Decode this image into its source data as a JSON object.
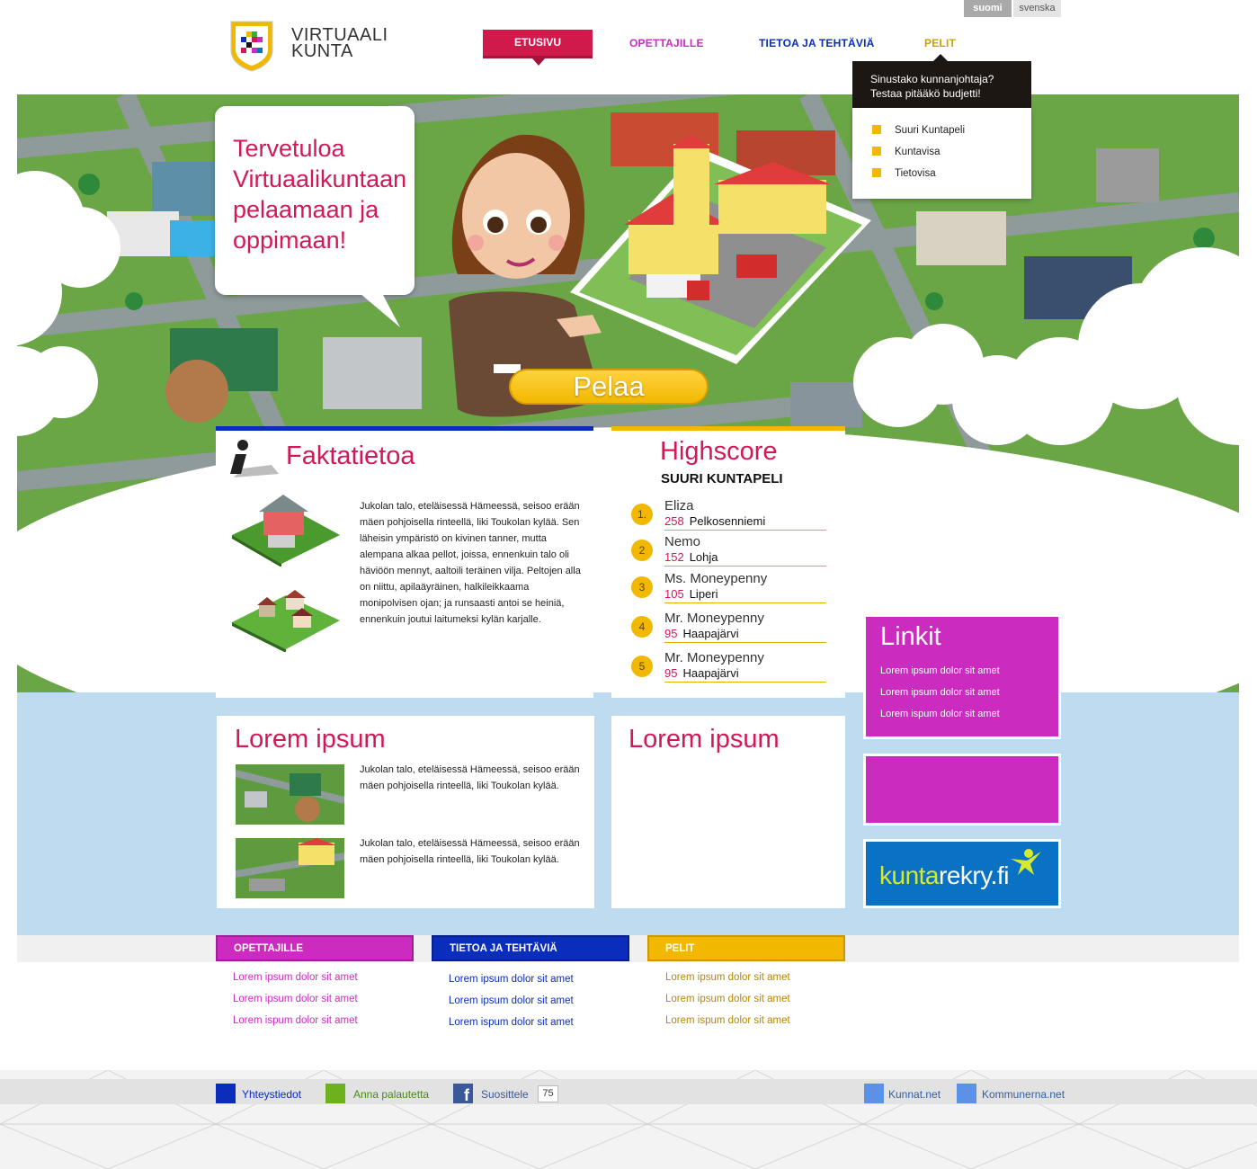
{
  "lang": {
    "active": "suomi",
    "other": "svenska"
  },
  "logo": {
    "line1": "VIRTUAALI",
    "line2": "KUNTA"
  },
  "nav": {
    "etusivu": "ETUSIVU",
    "opettajille": "OPETTAJILLE",
    "tietoa": "TIETOA JA TEHTÄVIÄ",
    "pelit": "PELIT"
  },
  "colors": {
    "pink": "#d11a55",
    "blue": "#0a2dbb",
    "magenta": "#cc2bc0",
    "yellow": "#f2b800",
    "sky": "#bfdbf0"
  },
  "hero": {
    "welcome": "Tervetuloa Virtuaalikuntaan pelaamaan ja oppimaan!",
    "play_button": "Pelaa"
  },
  "dropdown": {
    "line1": "Sinustako kunnanjohtaja?",
    "line2": "Testaa pitääkö budjetti!",
    "items": [
      "Suuri Kuntapeli",
      "Kuntavisa",
      "Tietovisa"
    ]
  },
  "fakta": {
    "title": "Faktatietoa",
    "text": "Jukolan talo, eteläisessä Hämeessä, seisoo erään mäen pohjoisella rinteellä, liki Toukolan kylää. Sen läheisin ympäristö on kivinen tanner, mutta alempana alkaa pellot, joissa, ennenkuin talo oli häviöön mennyt, aaltoili teräinen vilja. Peltojen alla on niittu, apilaäyräinen, halkileikkaama monipolvisen ojan; ja runsaasti antoi se heiniä, ennenkuin joutui laitumeksi kylän karjalle."
  },
  "highscore": {
    "title": "Highscore",
    "subtitle": "SUURI KUNTAPELI",
    "entries": [
      {
        "rank": "1.",
        "name": "Eliza",
        "score": "258",
        "city": "Pelkosenniemi"
      },
      {
        "rank": "2",
        "name": "Nemo",
        "score": "152",
        "city": "Lohja"
      },
      {
        "rank": "3",
        "name": "Ms. Moneypenny",
        "score": "105",
        "city": "Liperi"
      },
      {
        "rank": "4",
        "name": "Mr. Moneypenny",
        "score": "95",
        "city": "Haapajärvi"
      },
      {
        "rank": "5",
        "name": "Mr. Moneypenny",
        "score": "95",
        "city": "Haapajärvi"
      }
    ]
  },
  "lorem1": {
    "title": "Lorem ipsum",
    "items": [
      "Jukolan talo, eteläisessä Hämeessä, seisoo erään mäen pohjoisella rinteellä, liki Toukolan kylää.",
      "Jukolan talo, eteläisessä Hämeessä, seisoo erään mäen pohjoisella rinteellä, liki Toukolan kylää."
    ]
  },
  "lorem2": {
    "title": "Lorem ipsum"
  },
  "linkit": {
    "title": "Linkit",
    "links": [
      "Lorem ipsum dolor sit amet",
      "Lorem ipsum dolor sit amet",
      "Lorem ispum dolor sit amet"
    ]
  },
  "rekry": {
    "part1": "kunta",
    "part2": "rekry",
    "part3": ".fi"
  },
  "footer": {
    "opettajille": {
      "title": "OPETTAJILLE",
      "links": [
        "Lorem ipsum dolor sit amet",
        "Lorem ipsum dolor sit amet",
        "Lorem ispum dolor sit amet"
      ]
    },
    "tietoa": {
      "title": "TIETOA JA TEHTÄVIÄ",
      "links": [
        "Lorem ipsum dolor sit amet",
        "Lorem ipsum dolor sit amet",
        "Lorem ispum dolor sit amet"
      ]
    },
    "pelit": {
      "title": "PELIT",
      "links": [
        "Lorem ipsum dolor sit amet",
        "Lorem ipsum dolor sit amet",
        "Lorem ispum dolor sit amet"
      ]
    }
  },
  "bottom": {
    "yhteystiedot": "Yhteystiedot",
    "palaute": "Anna palautetta",
    "suosittele": "Suosittele",
    "like_count": "75",
    "kunnat": "Kunnat.net",
    "kommunerna": "Kommunerna.net"
  }
}
